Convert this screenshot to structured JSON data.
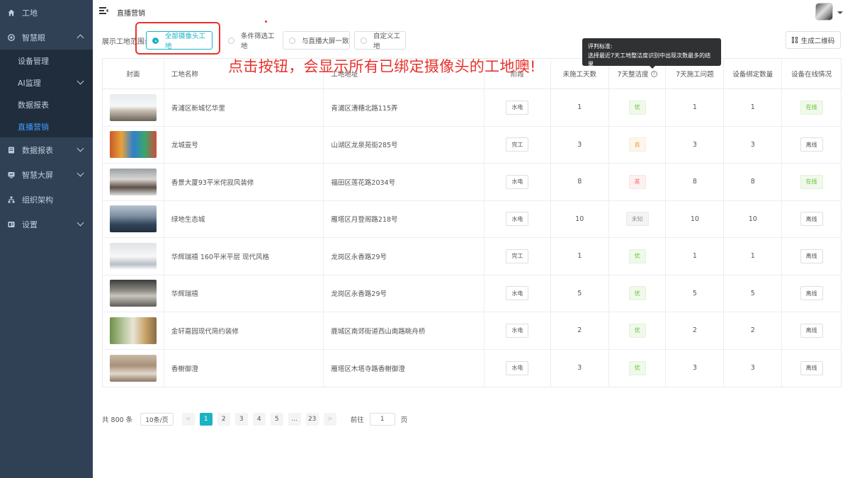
{
  "sidebar": {
    "items": [
      {
        "label": "工地",
        "icon": "home-icon"
      },
      {
        "label": "智慧眼",
        "icon": "eye-icon",
        "expanded": true,
        "children": [
          {
            "label": "设备管理"
          },
          {
            "label": "AI监理"
          },
          {
            "label": "数据报表"
          },
          {
            "label": "直播营销",
            "active": true
          }
        ]
      },
      {
        "label": "数据报表",
        "icon": "report-icon"
      },
      {
        "label": "智慧大屏",
        "icon": "screen-icon"
      },
      {
        "label": "组织架构",
        "icon": "org-icon"
      },
      {
        "label": "设置",
        "icon": "settings-icon"
      }
    ]
  },
  "header": {
    "breadcrumb": "直播营销"
  },
  "filter": {
    "label": "展示工地范围:",
    "options": [
      {
        "label": "全部摄像头工地",
        "checked": true
      },
      {
        "label": "条件筛选工地",
        "checked": false
      },
      {
        "label": "与直播大屏一致",
        "checked": false
      },
      {
        "label": "自定义工地",
        "checked": false
      }
    ],
    "qr_button": "生成二维码"
  },
  "tooltip": {
    "title": "评判标准:",
    "body": "选择最近7天工地整洁度识别中出现次数最多的结果"
  },
  "annotation": "点击按钮，会显示所有已绑定摄像头的工地噢!",
  "table": {
    "headers": {
      "cover": "封面",
      "name": "工地名称",
      "address": "工地地址",
      "stage": "阶段",
      "idle_days": "未施工天数",
      "cleanliness": "7天整洁度",
      "issues": "7天施工问题",
      "bound_devices": "设备绑定数量",
      "online": "设备在线情况"
    },
    "rows": [
      {
        "name": "青浦区新城忆华里",
        "address": "青浦区漕穗北路115弄",
        "stage": "水电",
        "idle_days": "1",
        "cleanliness": "优",
        "clean_level": "good",
        "issues": "1",
        "bound": "1",
        "online": "在线",
        "is_online": true,
        "thumb": "bright"
      },
      {
        "name": "龙城壹号",
        "address": "山湖区龙泉苑街285号",
        "stage": "完工",
        "idle_days": "3",
        "cleanliness": "良",
        "clean_level": "mid",
        "issues": "3",
        "bound": "3",
        "online": "离线",
        "is_online": false,
        "thumb": "colorful"
      },
      {
        "name": "香景大厦93平米侘寂风装修",
        "address": "福田区莲花路2034号",
        "stage": "水电",
        "idle_days": "8",
        "cleanliness": "差",
        "clean_level": "bad",
        "issues": "8",
        "bound": "8",
        "online": "在线",
        "is_online": true,
        "thumb": "meeting"
      },
      {
        "name": "绿地生态城",
        "address": "雁塔区月登阁路218号",
        "stage": "水电",
        "idle_days": "10",
        "cleanliness": "未知",
        "clean_level": "unknown",
        "issues": "10",
        "bound": "10",
        "online": "离线",
        "is_online": false,
        "thumb": "office"
      },
      {
        "name": "华辉瑞禧 160平米平层 现代风格",
        "address": "龙岗区永香路29号",
        "stage": "完工",
        "idle_days": "1",
        "cleanliness": "优",
        "clean_level": "good",
        "issues": "1",
        "bound": "1",
        "online": "离线",
        "is_online": false,
        "thumb": "white"
      },
      {
        "name": "华辉瑞禧",
        "address": "龙岗区永香路29号",
        "stage": "水电",
        "idle_days": "5",
        "cleanliness": "优",
        "clean_level": "good",
        "issues": "5",
        "bound": "5",
        "online": "离线",
        "is_online": false,
        "thumb": "dark"
      },
      {
        "name": "金轩嘉园现代简约装修",
        "address": "鹿城区南郊街道西山南路眺舟桥",
        "stage": "水电",
        "idle_days": "2",
        "cleanliness": "优",
        "clean_level": "good",
        "issues": "2",
        "bound": "2",
        "online": "离线",
        "is_online": false,
        "thumb": "plants"
      },
      {
        "name": "香榭御澄",
        "address": "雁塔区木塔寺路香榭御澄",
        "stage": "水电",
        "idle_days": "3",
        "cleanliness": "优",
        "clean_level": "good",
        "issues": "3",
        "bound": "3",
        "online": "离线",
        "is_online": false,
        "thumb": "lounge"
      }
    ]
  },
  "pagination": {
    "total": "共 800 条",
    "page_size": "10条/页",
    "prev": "<",
    "pages": [
      "1",
      "2",
      "3",
      "4",
      "5",
      "...",
      "23"
    ],
    "current": "1",
    "next": ">",
    "goto_label": "前往",
    "goto_value": "1",
    "goto_suffix": "页"
  },
  "colors": {
    "sidebar_bg": "#304156",
    "submenu_bg": "#1f2d3d",
    "active_link": "#409eff",
    "accent": "#1ab3c4",
    "annotation_red": "#e8322c"
  }
}
